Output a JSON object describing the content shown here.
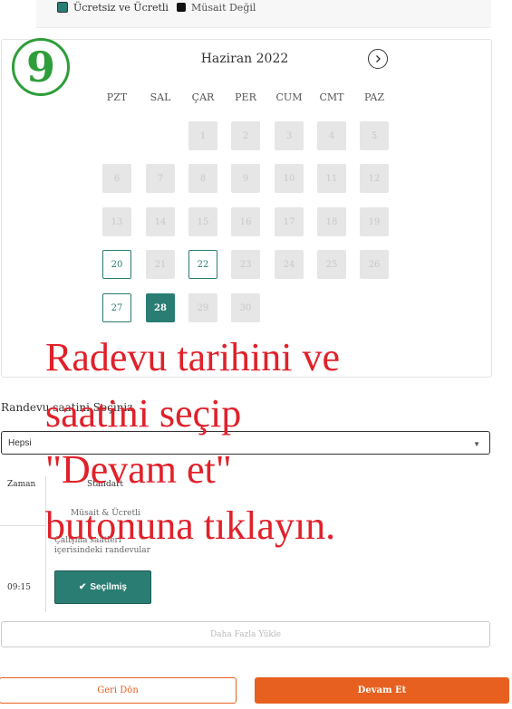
{
  "legend": {
    "free_paid": "Ücretsiz ve Ücretli",
    "not_available": "Müsait Değil",
    "free_paid_color": "#2a7d72",
    "not_available_color": "#111111"
  },
  "step_badge": "9",
  "calendar": {
    "month_title": "Haziran 2022",
    "next_icon": "chevron-right-icon",
    "weekdays": [
      "PZT",
      "SAL",
      "ÇAR",
      "PER",
      "CUM",
      "CMT",
      "PAZ"
    ],
    "days": [
      {
        "label": "1",
        "state": "disabled"
      },
      {
        "label": "2",
        "state": "disabled"
      },
      {
        "label": "3",
        "state": "disabled"
      },
      {
        "label": "4",
        "state": "disabled"
      },
      {
        "label": "5",
        "state": "disabled"
      },
      {
        "label": "6",
        "state": "disabled"
      },
      {
        "label": "7",
        "state": "disabled"
      },
      {
        "label": "8",
        "state": "disabled"
      },
      {
        "label": "9",
        "state": "disabled"
      },
      {
        "label": "10",
        "state": "disabled"
      },
      {
        "label": "11",
        "state": "disabled"
      },
      {
        "label": "12",
        "state": "disabled"
      },
      {
        "label": "13",
        "state": "disabled"
      },
      {
        "label": "14",
        "state": "disabled"
      },
      {
        "label": "15",
        "state": "disabled"
      },
      {
        "label": "16",
        "state": "disabled"
      },
      {
        "label": "17",
        "state": "disabled"
      },
      {
        "label": "18",
        "state": "disabled"
      },
      {
        "label": "19",
        "state": "disabled"
      },
      {
        "label": "20",
        "state": "available"
      },
      {
        "label": "21",
        "state": "disabled"
      },
      {
        "label": "22",
        "state": "available"
      },
      {
        "label": "23",
        "state": "disabled"
      },
      {
        "label": "24",
        "state": "disabled"
      },
      {
        "label": "25",
        "state": "disabled"
      },
      {
        "label": "26",
        "state": "disabled"
      },
      {
        "label": "27",
        "state": "available"
      },
      {
        "label": "28",
        "state": "selected"
      },
      {
        "label": "29",
        "state": "disabled"
      },
      {
        "label": "30",
        "state": "disabled"
      }
    ]
  },
  "time_section": {
    "label": "Randevu saatini Seçiniz",
    "filter_value": "Hepsi",
    "col_time": "Zaman",
    "col_standard": "Standart",
    "availability": "Müsait & Ücretli",
    "note": "Çalışma saatleri içerisindeki randevular",
    "slot_time": "09:15",
    "slot_button": "Seçilmiş",
    "load_more": "Daha Fazla Yükle"
  },
  "footer": {
    "back": "Geri Dön",
    "continue": "Devam Et",
    "accent_color": "#e8601f"
  },
  "overlay_text": [
    "Radevu tarihini ve",
    "saatini seçip",
    "\"Devam et\"",
    "butonuna tıklayın."
  ]
}
